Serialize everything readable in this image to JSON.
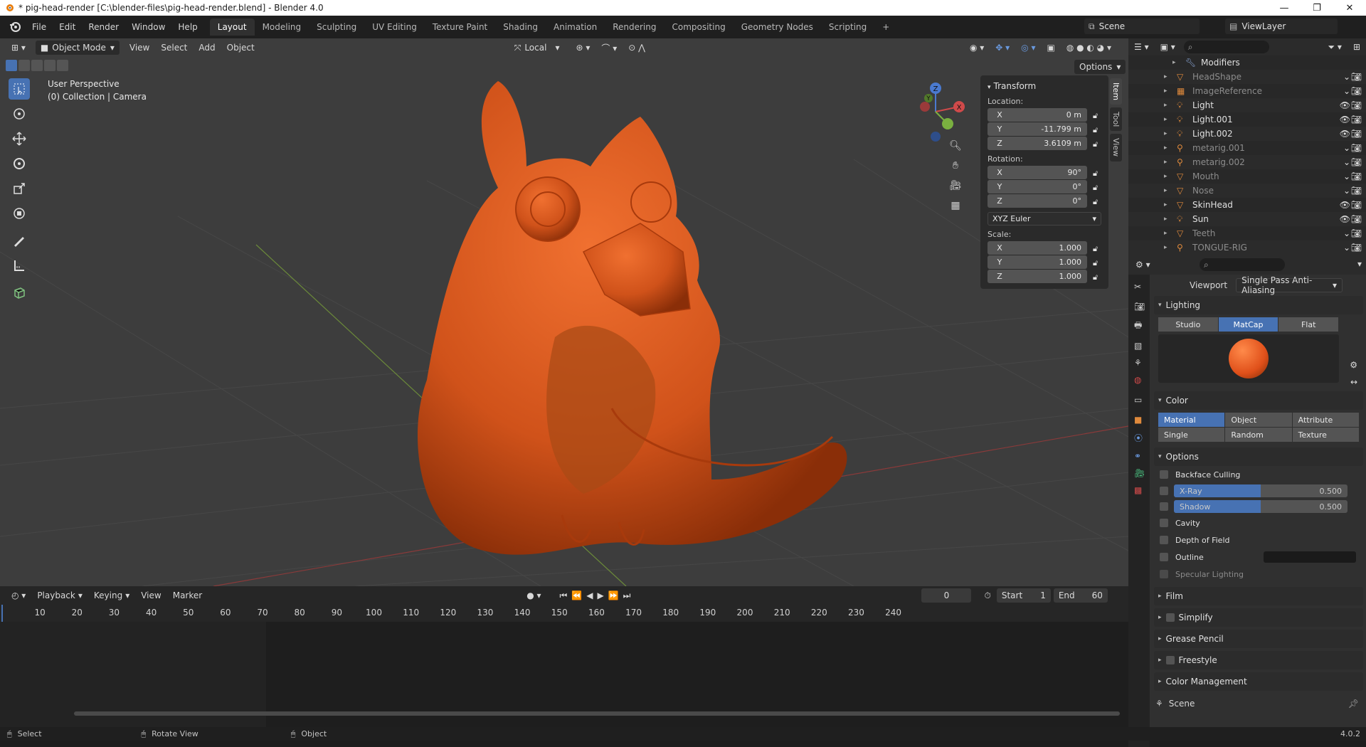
{
  "window": {
    "title": "* pig-head-render [C:\\blender-files\\pig-head-render.blend] - Blender 4.0",
    "minimize": "—",
    "maximize": "❐",
    "close": "✕"
  },
  "menu": [
    "File",
    "Edit",
    "Render",
    "Window",
    "Help"
  ],
  "workspaces": [
    {
      "label": "Layout",
      "active": true
    },
    {
      "label": "Modeling"
    },
    {
      "label": "Sculpting"
    },
    {
      "label": "UV Editing"
    },
    {
      "label": "Texture Paint"
    },
    {
      "label": "Shading"
    },
    {
      "label": "Animation"
    },
    {
      "label": "Rendering"
    },
    {
      "label": "Compositing"
    },
    {
      "label": "Geometry Nodes"
    },
    {
      "label": "Scripting"
    },
    {
      "label": "+"
    }
  ],
  "scene": {
    "name": "Scene"
  },
  "view_layer": {
    "name": "ViewLayer"
  },
  "viewport_header": {
    "mode": "Object Mode",
    "view": "View",
    "select": "Select",
    "add": "Add",
    "object": "Object",
    "transform_orientation": "Local",
    "options": "Options"
  },
  "viewport": {
    "perspective": "User Perspective",
    "collection": "(0) Collection | Camera"
  },
  "npanel": {
    "section": "Transform",
    "location_label": "Location:",
    "location": [
      {
        "axis": "X",
        "value": "0 m"
      },
      {
        "axis": "Y",
        "value": "-11.799 m"
      },
      {
        "axis": "Z",
        "value": "3.6109 m"
      }
    ],
    "rotation_label": "Rotation:",
    "rotation": [
      {
        "axis": "X",
        "value": "90°"
      },
      {
        "axis": "Y",
        "value": "0°"
      },
      {
        "axis": "Z",
        "value": "0°"
      }
    ],
    "rotation_mode": "XYZ Euler",
    "scale_label": "Scale:",
    "scale": [
      {
        "axis": "X",
        "value": "1.000"
      },
      {
        "axis": "Y",
        "value": "1.000"
      },
      {
        "axis": "Z",
        "value": "1.000"
      }
    ],
    "tabs": [
      "Item",
      "Tool",
      "View"
    ]
  },
  "gizmo": {
    "x": "X",
    "y": "Y",
    "z": "Z"
  },
  "outliner": {
    "rows": [
      {
        "name": "Modifiers",
        "icon": "wrench-icon",
        "color": "#8aa6d6",
        "dim": false,
        "sub": true
      },
      {
        "name": "HeadShape",
        "icon": "mesh-icon",
        "color": "#e08a3c",
        "dim": true
      },
      {
        "name": "ImageReference",
        "icon": "image-icon",
        "color": "#e08a3c",
        "dim": true
      },
      {
        "name": "Light",
        "icon": "light-icon",
        "color": "#e08a3c",
        "dim": false
      },
      {
        "name": "Light.001",
        "icon": "light-icon",
        "color": "#e08a3c",
        "dim": false
      },
      {
        "name": "Light.002",
        "icon": "light-icon",
        "color": "#e08a3c",
        "dim": false
      },
      {
        "name": "metarig.001",
        "icon": "armature-icon",
        "color": "#e08a3c",
        "dim": true
      },
      {
        "name": "metarig.002",
        "icon": "armature-icon",
        "color": "#e08a3c",
        "dim": true
      },
      {
        "name": "Mouth",
        "icon": "mesh-icon",
        "color": "#e08a3c",
        "dim": true
      },
      {
        "name": "Nose",
        "icon": "mesh-icon",
        "color": "#e08a3c",
        "dim": true
      },
      {
        "name": "SkinHead",
        "icon": "mesh-icon",
        "color": "#e08a3c",
        "dim": false
      },
      {
        "name": "Sun",
        "icon": "light-icon",
        "color": "#e08a3c",
        "dim": false
      },
      {
        "name": "Teeth",
        "icon": "mesh-icon",
        "color": "#e08a3c",
        "dim": true
      },
      {
        "name": "TONGUE-RIG",
        "icon": "armature-icon",
        "color": "#e08a3c",
        "dim": true
      }
    ]
  },
  "properties": {
    "viewport_label": "Viewport",
    "viewport_value": "Single Pass Anti-Aliasing",
    "lighting": "Lighting",
    "lighting_modes": [
      {
        "label": "Studio"
      },
      {
        "label": "MatCap",
        "on": true
      },
      {
        "label": "Flat"
      }
    ],
    "color": "Color",
    "color_modes": [
      {
        "label": "Material",
        "on": true
      },
      {
        "label": "Object"
      },
      {
        "label": "Attribute"
      },
      {
        "label": "Single"
      },
      {
        "label": "Random"
      },
      {
        "label": "Texture"
      }
    ],
    "options": "Options",
    "backface_culling": "Backface Culling",
    "xray": {
      "label": "X-Ray",
      "value": "0.500",
      "fraction": 0.5
    },
    "shadow": {
      "label": "Shadow",
      "value": "0.500",
      "fraction": 0.5
    },
    "cavity": "Cavity",
    "dof": "Depth of Field",
    "outline": "Outline",
    "specular": "Specular Lighting",
    "sections": [
      "Film",
      "Simplify",
      "Grease Pencil",
      "Freestyle",
      "Color Management"
    ],
    "scene_label": "Scene"
  },
  "timeline": {
    "playback": "Playback",
    "keying": "Keying",
    "view": "View",
    "marker": "Marker",
    "current_frame": "0",
    "start_label": "Start",
    "start": "1",
    "end_label": "End",
    "end": "60",
    "ticks": [
      "10",
      "20",
      "30",
      "40",
      "50",
      "60",
      "70",
      "80",
      "90",
      "100",
      "110",
      "120",
      "130",
      "140",
      "150",
      "160",
      "170",
      "180",
      "190",
      "200",
      "210",
      "220",
      "230",
      "240"
    ]
  },
  "status": {
    "select": "Select",
    "rotate": "Rotate View",
    "object": "Object",
    "version": "4.0.2"
  },
  "colors": {
    "accent": "#4772b3",
    "model": "#d0521a"
  }
}
